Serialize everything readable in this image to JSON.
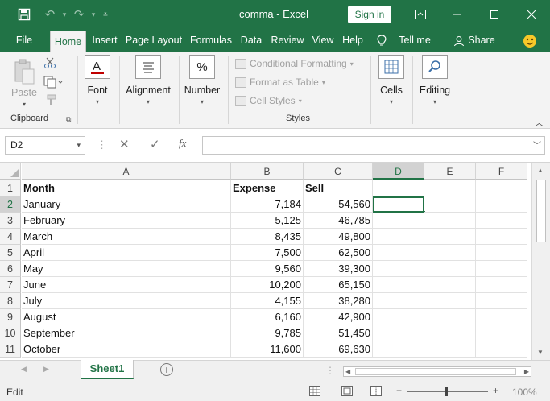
{
  "titlebar": {
    "doc_title": "comma  -  Excel",
    "signin_label": "Sign in",
    "save_icon": "save-icon",
    "undo_icon": "undo-icon",
    "redo_icon": "redo-icon",
    "customize_icon": "customize-qat-icon"
  },
  "tabs": {
    "file": "File",
    "home": "Home",
    "insert": "Insert",
    "page_layout": "Page Layout",
    "formulas": "Formulas",
    "data": "Data",
    "review": "Review",
    "view": "View",
    "help": "Help",
    "tell_me": "Tell me",
    "share": "Share"
  },
  "ribbon": {
    "clipboard": {
      "paste": "Paste",
      "group_label": "Clipboard"
    },
    "font": "Font",
    "alignment": "Alignment",
    "number": "Number",
    "styles": {
      "conditional_formatting": "Conditional Formatting",
      "format_as_table": "Format as Table",
      "cell_styles": "Cell Styles",
      "group_label": "Styles"
    },
    "cells": "Cells",
    "editing": "Editing"
  },
  "formula_bar": {
    "name_box": "D2",
    "formula": "",
    "fx_label": "fx"
  },
  "grid": {
    "columns": [
      "A",
      "B",
      "C",
      "D",
      "E",
      "F"
    ],
    "selected_column": "D",
    "rows": [
      {
        "n": "1",
        "a": "Month",
        "b": "Expense",
        "c": "Sell"
      },
      {
        "n": "2",
        "a": "January",
        "b": "7,184",
        "c": "54,560"
      },
      {
        "n": "3",
        "a": "February",
        "b": "5,125",
        "c": "46,785"
      },
      {
        "n": "4",
        "a": "March",
        "b": "8,435",
        "c": "49,800"
      },
      {
        "n": "5",
        "a": "April",
        "b": "7,500",
        "c": "62,500"
      },
      {
        "n": "6",
        "a": "May",
        "b": "9,560",
        "c": "39,300"
      },
      {
        "n": "7",
        "a": "June",
        "b": "10,200",
        "c": "65,150"
      },
      {
        "n": "8",
        "a": "July",
        "b": "4,155",
        "c": "38,280"
      },
      {
        "n": "9",
        "a": "August",
        "b": "6,160",
        "c": "42,900"
      },
      {
        "n": "10",
        "a": "September",
        "b": "9,785",
        "c": "51,450"
      },
      {
        "n": "11",
        "a": "October",
        "b": "11,600",
        "c": "69,630"
      }
    ],
    "selected_row": "2"
  },
  "sheets": {
    "active": "Sheet1"
  },
  "status": {
    "mode": "Edit",
    "zoom": "100%"
  },
  "colors": {
    "brand": "#217346",
    "ribbon_bg": "#f3f3f3"
  }
}
